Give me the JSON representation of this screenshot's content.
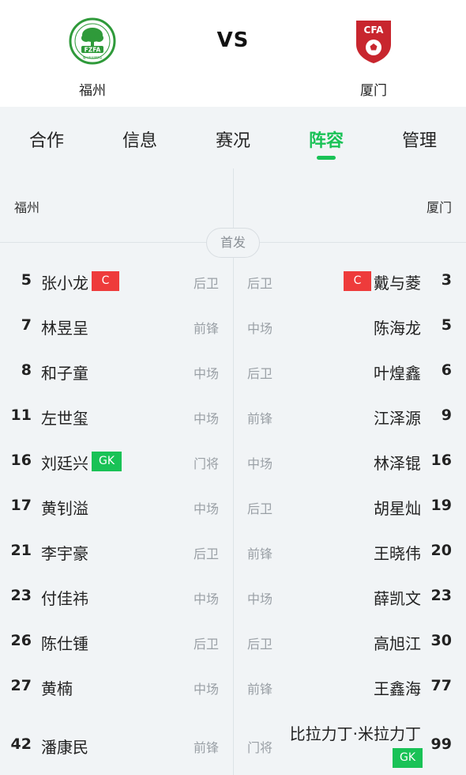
{
  "match": {
    "home_team": "福州",
    "away_team": "厦门",
    "vs_label": "VS",
    "home_logo_text": "FZFA",
    "home_logo_subtext": "福州市足球协会",
    "away_logo_text": "CFA",
    "colors": {
      "accent": "#19c256",
      "captain_badge": "#ee3b3b",
      "gk_badge": "#19c256",
      "home_logo": "#2f9a3a",
      "away_logo": "#c8262e"
    }
  },
  "tabs": [
    {
      "label": "合作",
      "active": false
    },
    {
      "label": "信息",
      "active": false
    },
    {
      "label": "赛况",
      "active": false
    },
    {
      "label": "阵容",
      "active": true
    },
    {
      "label": "管理",
      "active": false
    }
  ],
  "lineup": {
    "home_label": "福州",
    "away_label": "厦门",
    "section_title": "首发",
    "rows": [
      {
        "home": {
          "number": "5",
          "name": "张小龙",
          "position": "后卫",
          "badge": "C"
        },
        "away": {
          "number": "3",
          "name": "戴与菱",
          "position": "后卫",
          "badge": "C"
        }
      },
      {
        "home": {
          "number": "7",
          "name": "林昱呈",
          "position": "前锋"
        },
        "away": {
          "number": "5",
          "name": "陈海龙",
          "position": "中场"
        }
      },
      {
        "home": {
          "number": "8",
          "name": "和子童",
          "position": "中场"
        },
        "away": {
          "number": "6",
          "name": "叶煌鑫",
          "position": "后卫"
        }
      },
      {
        "home": {
          "number": "11",
          "name": "左世玺",
          "position": "中场"
        },
        "away": {
          "number": "9",
          "name": "江泽源",
          "position": "前锋"
        }
      },
      {
        "home": {
          "number": "16",
          "name": "刘廷兴",
          "position": "门将",
          "badge": "GK"
        },
        "away": {
          "number": "16",
          "name": "林泽锟",
          "position": "中场"
        }
      },
      {
        "home": {
          "number": "17",
          "name": "黄钊溢",
          "position": "中场"
        },
        "away": {
          "number": "19",
          "name": "胡星灿",
          "position": "后卫"
        }
      },
      {
        "home": {
          "number": "21",
          "name": "李宇豪",
          "position": "后卫"
        },
        "away": {
          "number": "20",
          "name": "王晓伟",
          "position": "前锋"
        }
      },
      {
        "home": {
          "number": "23",
          "name": "付佳祎",
          "position": "中场"
        },
        "away": {
          "number": "23",
          "name": "薛凯文",
          "position": "中场"
        }
      },
      {
        "home": {
          "number": "26",
          "name": "陈仕锺",
          "position": "后卫"
        },
        "away": {
          "number": "30",
          "name": "高旭江",
          "position": "后卫"
        }
      },
      {
        "home": {
          "number": "27",
          "name": "黄楠",
          "position": "中场"
        },
        "away": {
          "number": "77",
          "name": "王鑫海",
          "position": "前锋"
        }
      },
      {
        "home": {
          "number": "42",
          "name": "潘康民",
          "position": "前锋"
        },
        "away": {
          "number": "99",
          "name": "比拉力丁·米拉力丁",
          "position": "门将",
          "badge": "GK"
        }
      }
    ]
  }
}
